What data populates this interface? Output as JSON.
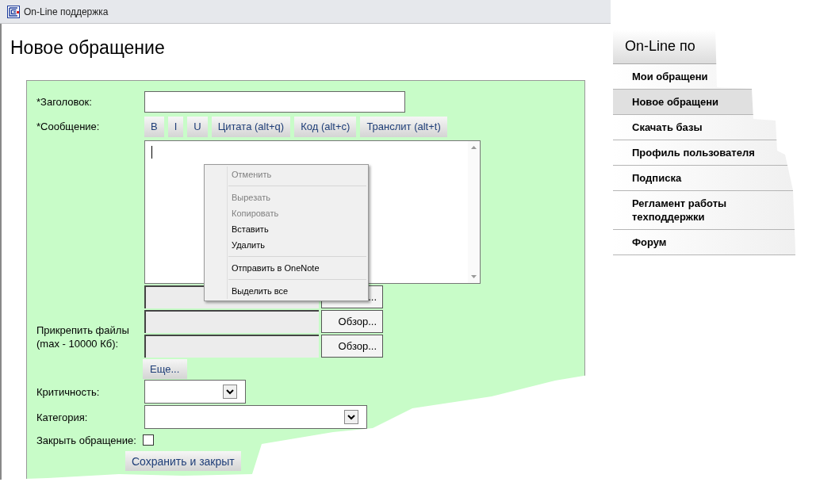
{
  "window": {
    "title": "On-Line поддержка"
  },
  "page": {
    "heading": "Новое обращение"
  },
  "form": {
    "title_label": "*Заголовок:",
    "message_label": "*Сообщение:",
    "toolbar": [
      {
        "label": "B"
      },
      {
        "label": "I"
      },
      {
        "label": "U"
      },
      {
        "label": "Цитата (alt+q)"
      },
      {
        "label": "Код (alt+c)"
      },
      {
        "label": "Транслит (alt+t)"
      }
    ],
    "attach_label": "Прикрепить файлы (max - 10000 Кб):",
    "file_rows": [
      {
        "button": "..."
      },
      {
        "button": "Обзор..."
      },
      {
        "button": "Обзор..."
      }
    ],
    "more_button": "Еще...",
    "criticality_label": "Критичность:",
    "category_label": "Категория:",
    "close_label": "Закрыть обращение:",
    "close_checked": false,
    "save_button": "Сохранить и закрыт"
  },
  "context_menu": [
    {
      "kind": "item",
      "label": "Отменить",
      "disabled": true
    },
    {
      "kind": "separator"
    },
    {
      "kind": "item",
      "label": "Вырезать",
      "disabled": true
    },
    {
      "kind": "item",
      "label": "Копировать",
      "disabled": true
    },
    {
      "kind": "item",
      "label": "Вставить",
      "disabled": false
    },
    {
      "kind": "item",
      "label": "Удалить",
      "disabled": false
    },
    {
      "kind": "separator"
    },
    {
      "kind": "item",
      "label": "Отправить в OneNote",
      "disabled": false
    },
    {
      "kind": "separator"
    },
    {
      "kind": "item",
      "label": "Выделить все",
      "disabled": false
    }
  ],
  "sidebar": {
    "header": "On-Line по",
    "items": [
      {
        "label": "Мои обращени",
        "selected": false
      },
      {
        "label": "Новое обращени",
        "selected": true
      },
      {
        "label": "Скачать базы",
        "selected": false
      },
      {
        "label": "Профиль пользователя",
        "selected": false
      },
      {
        "label": "Подписка",
        "selected": false
      },
      {
        "label": "Регламент работы техподдержки",
        "selected": false
      },
      {
        "label": "Форум",
        "selected": false
      }
    ]
  }
}
